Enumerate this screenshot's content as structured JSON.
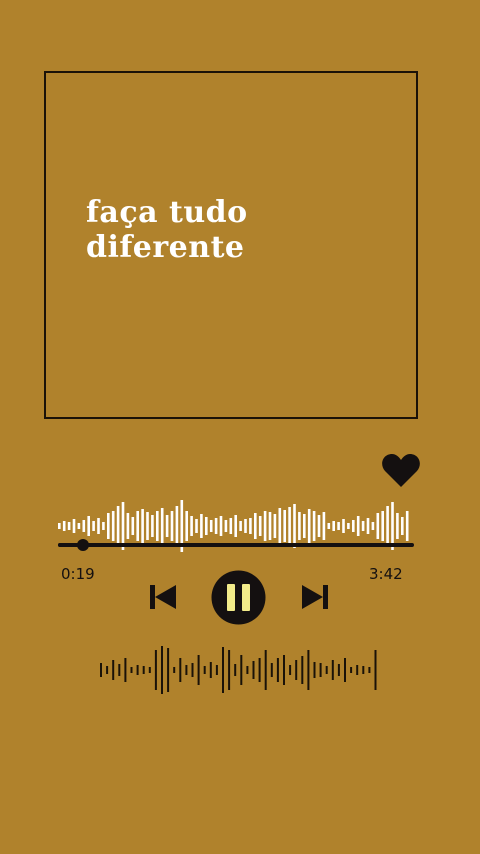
{
  "artwork": {
    "title": "faça tudo diferente"
  },
  "player": {
    "liked": true,
    "elapsed": "0:19",
    "duration": "3:42",
    "progress": 0.07,
    "state": "playing"
  },
  "icons": {
    "like": "heart-icon",
    "previous": "skip-previous-icon",
    "pause": "pause-icon",
    "next": "skip-next-icon"
  },
  "colors": {
    "background": "#b0822c",
    "ink": "#141010",
    "waveform_top": "#ffffff",
    "pause_glyph": "#f3ec8a"
  }
}
